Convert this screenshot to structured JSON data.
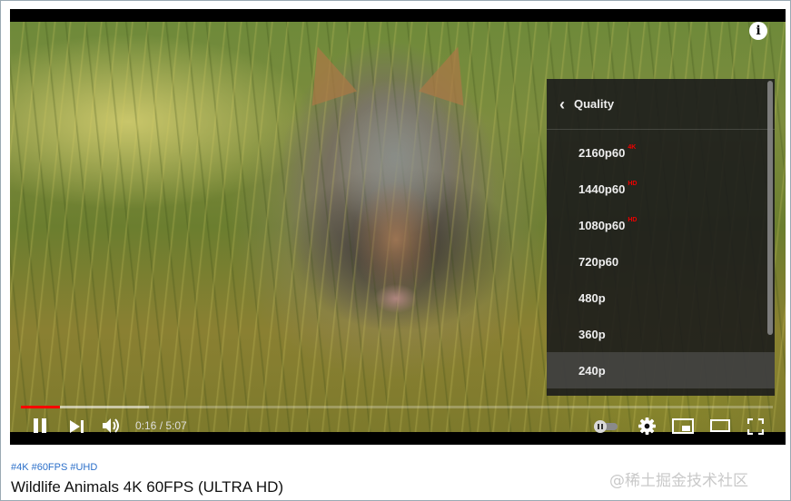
{
  "player": {
    "info_icon": "info-icon",
    "progress": {
      "played_fraction": 0.052,
      "loaded_fraction": 0.17
    },
    "time": {
      "current": "0:16",
      "separator": " / ",
      "duration": "5:07"
    },
    "controls": {
      "pause_icon": "pause-icon",
      "next_icon": "next-icon",
      "volume_icon": "volume-icon",
      "autoplay_icon": "autoplay-toggle-icon",
      "settings_icon": "gear-icon",
      "miniplayer_icon": "miniplayer-icon",
      "theater_icon": "theater-mode-icon",
      "fullscreen_icon": "fullscreen-icon"
    },
    "quality_menu": {
      "title": "Quality",
      "back_icon": "chevron-left-icon",
      "options": [
        {
          "label": "2160p60",
          "badge": "4K"
        },
        {
          "label": "1440p60",
          "badge": "HD"
        },
        {
          "label": "1080p60",
          "badge": "HD"
        },
        {
          "label": "720p60",
          "badge": ""
        },
        {
          "label": "480p",
          "badge": ""
        },
        {
          "label": "360p",
          "badge": ""
        },
        {
          "label": "240p",
          "badge": ""
        }
      ],
      "highlighted": "240p",
      "badge_color": "#e00000"
    }
  },
  "video": {
    "hashtags": [
      "#4K",
      "#60FPS",
      "#UHD"
    ],
    "title": "Wildlife Animals 4K 60FPS (ULTRA HD)"
  },
  "watermark": "@稀土掘金技术社区",
  "colors": {
    "progress_played": "#ff0000",
    "hashtag": "#2b6fc9",
    "menu_bg": "#1c1c1c"
  }
}
